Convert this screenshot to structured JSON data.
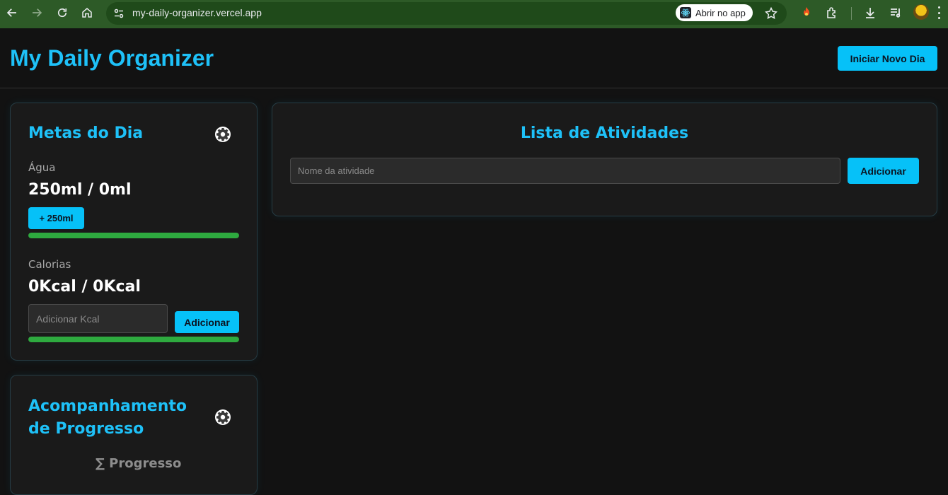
{
  "browser": {
    "url": "my-daily-organizer.vercel.app",
    "open_app_label": "Abrir no app"
  },
  "header": {
    "title": "My Daily Organizer",
    "new_day_label": "Iniciar Novo Dia"
  },
  "goals": {
    "title": "Metas do Dia",
    "water": {
      "label": "Água",
      "value": "250ml / 0ml",
      "add_label": "+ 250ml",
      "progress": 1.0
    },
    "calories": {
      "label": "Calorias",
      "value": "0Kcal / 0Kcal",
      "input_placeholder": "Adicionar Kcal",
      "add_label": "Adicionar",
      "progress": 1.0
    }
  },
  "progress_card": {
    "title": "Acompanhamento de Progresso",
    "subtitle": "∑ Progresso"
  },
  "activities": {
    "title": "Lista de Atividades",
    "input_placeholder": "Nome da atividade",
    "add_label": "Adicionar"
  },
  "colors": {
    "accent": "#1ec1f8",
    "button": "#06c1f8",
    "progress": "#2eaa3f",
    "chrome": "#2d5a27"
  }
}
